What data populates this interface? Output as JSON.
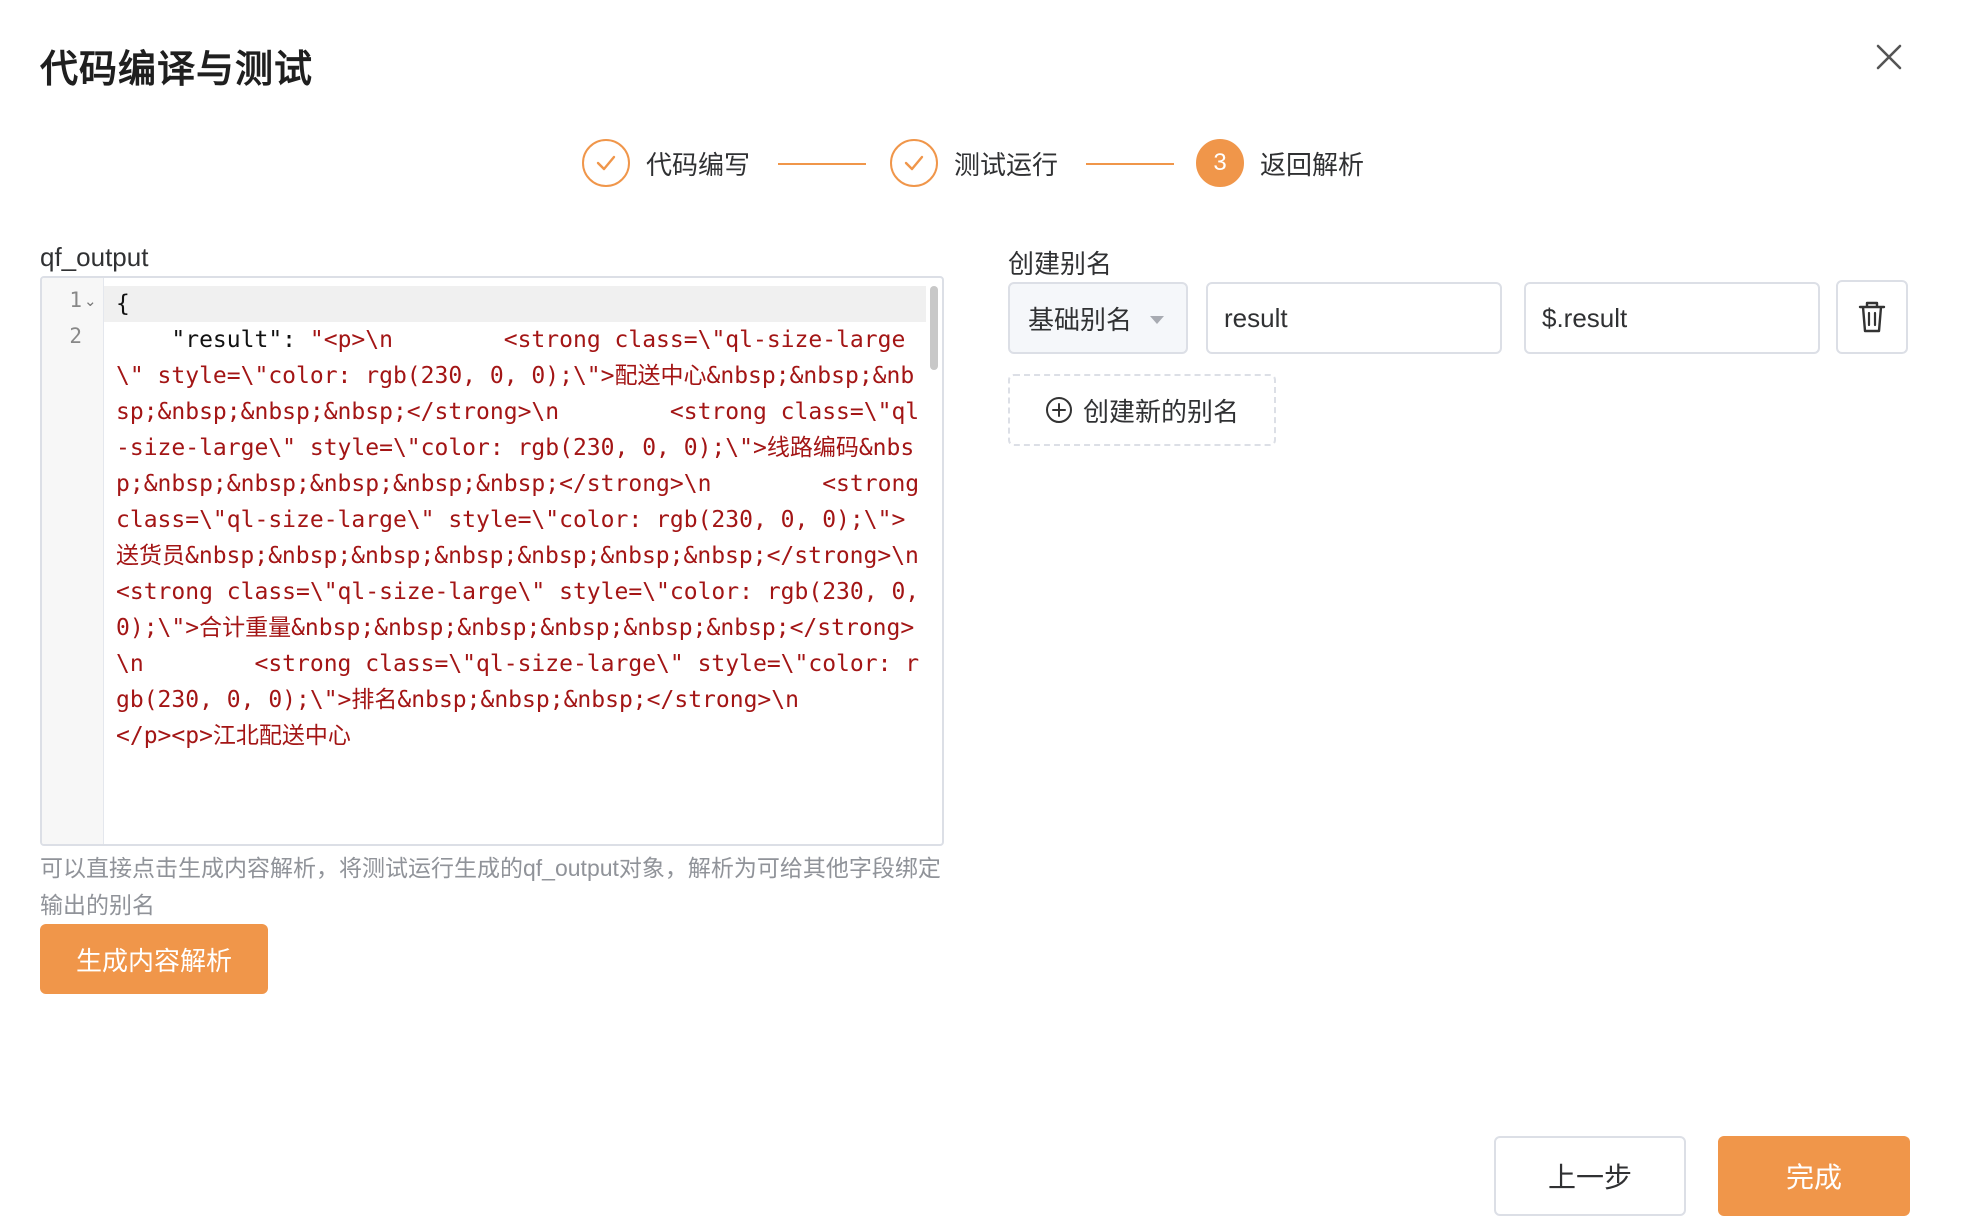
{
  "dialog": {
    "title": "代码编译与测试"
  },
  "steps": [
    {
      "label": "代码编写",
      "status": "finished",
      "icon": "check-icon"
    },
    {
      "label": "测试运行",
      "status": "finished",
      "icon": "check-icon"
    },
    {
      "label": "返回解析",
      "status": "active",
      "number": "3"
    }
  ],
  "editor": {
    "field_label": "qf_output",
    "line_numbers": [
      "1",
      "2"
    ],
    "code_line1": "{",
    "code_key": "    \"result\": ",
    "code_value": "\"<p>\\n        <strong class=\\\"ql-size-large\\\" style=\\\"color: rgb(230, 0, 0);\\\">配送中心&nbsp;&nbsp;&nbsp;&nbsp;&nbsp;&nbsp;</strong>\\n        <strong class=\\\"ql-size-large\\\" style=\\\"color: rgb(230, 0, 0);\\\">线路编码&nbsp;&nbsp;&nbsp;&nbsp;&nbsp;&nbsp;</strong>\\n        <strong class=\\\"ql-size-large\\\" style=\\\"color: rgb(230, 0, 0);\\\">送货员&nbsp;&nbsp;&nbsp;&nbsp;&nbsp;&nbsp;&nbsp;</strong>\\n        <strong class=\\\"ql-size-large\\\" style=\\\"color: rgb(230, 0, 0);\\\">合计重量&nbsp;&nbsp;&nbsp;&nbsp;&nbsp;&nbsp;</strong>\\n        <strong class=\\\"ql-size-large\\\" style=\\\"color: rgb(230, 0, 0);\\\">排名&nbsp;&nbsp;&nbsp;</strong>\\n        </p><p>江北配送中心"
  },
  "hint": "可以直接点击生成内容解析，将测试运行生成的qf_output对象，解析为可给其他字段绑定输出的别名",
  "generate_button": "生成内容解析",
  "alias": {
    "section_label": "创建别名",
    "type_select": "基础别名",
    "name_value": "result",
    "path_value": "$.result",
    "delete_icon": "trash-icon",
    "create_button": "创建新的别名",
    "create_icon": "plus-circle-icon"
  },
  "footer": {
    "prev_button": "上一步",
    "finish_button": "完成"
  },
  "colors": {
    "accent": "#f0964a",
    "code_string": "#a31515",
    "border": "#dcdfe6",
    "hint_text": "#909399"
  }
}
